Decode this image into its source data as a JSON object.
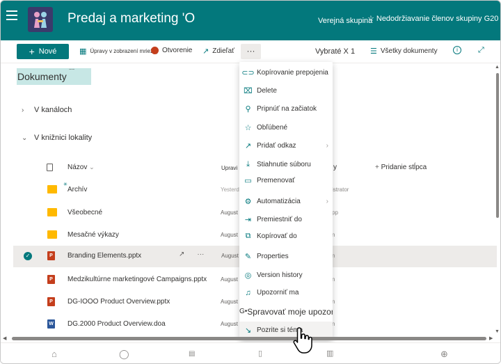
{
  "header": {
    "site_title": "Predaj a marketing 'O",
    "group_type": "Verejná skupina",
    "follow_label": "Nedodržiavanie členov skupiny G20"
  },
  "command_bar": {
    "new_label": "Nové",
    "edit_grid_label": "Úpravy v zobrazení mriežky",
    "open_label": "Otvorenie",
    "share_label": "Zdieľať",
    "more_label": "···",
    "selected_count_label": "Vybraté X 1",
    "view_label": "Všetky dokumenty"
  },
  "page": {
    "title": "Dokumenty",
    "title_badge": "~~"
  },
  "groups": [
    {
      "label": "V kanáloch",
      "expanded": false
    },
    {
      "label": "V knižnici lokality",
      "expanded": true
    }
  ],
  "columns": {
    "name": "Názov",
    "modified": "Upravi",
    "modified_by": "y",
    "add_column": "Pridanie stĺpca"
  },
  "rows": [
    {
      "name": "Archív",
      "type": "folder",
      "modified": "Yesterd",
      "modified_by": "istrator",
      "selected": false
    },
    {
      "name": "Všeobecné",
      "type": "folder",
      "modified": "August",
      "modified_by": "pp",
      "selected": false
    },
    {
      "name": "Mesačné výkazy",
      "type": "folder",
      "modified": "August",
      "modified_by": "n",
      "selected": false
    },
    {
      "name": "Branding Elements.pptx",
      "type": "ppt",
      "modified": "August",
      "modified_by": "n",
      "selected": true
    },
    {
      "name": "Medzikultúrne marketingové Campaigns.pptx",
      "type": "ppt",
      "modified": "August",
      "modified_by": "n",
      "selected": false
    },
    {
      "name": "DG-IOOO Product Overview.pptx",
      "type": "ppt",
      "modified": "August",
      "modified_by": "n",
      "selected": false
    },
    {
      "name": "DG.2000 Product Overview.doa",
      "type": "word",
      "modified": "August",
      "modified_by": "n",
      "selected": false
    }
  ],
  "menu": {
    "items": [
      {
        "label": "Kopírovanie prepojenia",
        "icon": "link-icon",
        "glyph": "⊂⊃",
        "submenu": false
      },
      {
        "label": "Delete",
        "icon": "trash-icon",
        "glyph": "🗑",
        "submenu": false
      },
      {
        "label": "Pripnúť na začiatok",
        "icon": "pin-icon",
        "glyph": "⚲",
        "submenu": false
      },
      {
        "label": "Obľúbené",
        "icon": "star-icon",
        "glyph": "☆",
        "submenu": false
      },
      {
        "label": "Pridať odkaz",
        "icon": "add-link-icon",
        "glyph": "↗",
        "submenu": true
      },
      {
        "label": "Stiahnutie súboru",
        "icon": "download-icon",
        "glyph": "⤓",
        "submenu": false
      },
      {
        "label": "Premenovať",
        "icon": "rename-icon",
        "glyph": "▭",
        "submenu": false
      },
      {
        "label": "Automatizácia",
        "icon": "automate-icon",
        "glyph": "⚙",
        "submenu": true
      },
      {
        "label": "Premiestniť do",
        "icon": "move-icon",
        "glyph": "⇥",
        "submenu": false
      },
      {
        "label": "Kopírovať do",
        "icon": "copy-icon",
        "glyph": "⧉",
        "submenu": false
      },
      {
        "label": "Properties",
        "icon": "pencil-icon",
        "glyph": "✎",
        "submenu": false
      },
      {
        "label": "Version history",
        "icon": "history-icon",
        "glyph": "◎",
        "submenu": false
      },
      {
        "label": "Upozorniť ma",
        "icon": "bell-icon",
        "glyph": "🔔",
        "submenu": false
      },
      {
        "label": "Spravovať moje upozornenia",
        "icon": "manage-alerts-icon",
        "glyph": "G•",
        "submenu": false
      },
      {
        "label": "Pozrite si téma",
        "icon": "arrow-icon",
        "glyph": "↘",
        "submenu": false
      }
    ]
  },
  "colors": {
    "brand": "#03787c",
    "header_bg": "#03787c",
    "selected_row": "#edebe9"
  }
}
